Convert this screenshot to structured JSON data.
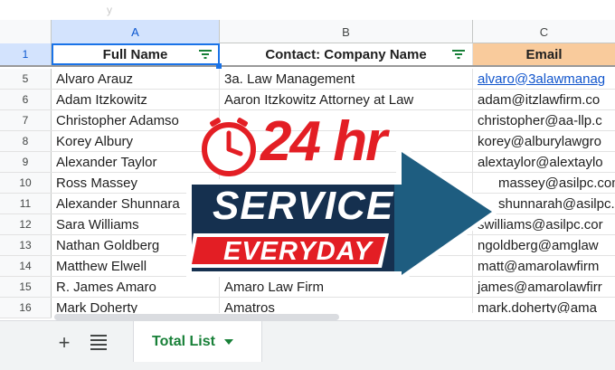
{
  "toolbar": {
    "faint_text": "y"
  },
  "columns": [
    {
      "letter": "A"
    },
    {
      "letter": "B"
    },
    {
      "letter": "C"
    }
  ],
  "header_row": {
    "number": "1",
    "cells": [
      "Full Name",
      "Contact: Company Name",
      "Email"
    ]
  },
  "rows": [
    {
      "num": "5",
      "name": "Alvaro Arauz",
      "company": "3a. Law Management",
      "email": "alvaro@3alawmanag"
    },
    {
      "num": "6",
      "name": "Adam Itzkowitz",
      "company": "Aaron Itzkowitz Attorney at Law",
      "email": "adam@itzlawfirm.co"
    },
    {
      "num": "7",
      "name": "Christopher Adamso",
      "company": "",
      "email": "christopher@aa-llp.c"
    },
    {
      "num": "8",
      "name": "Korey Albury",
      "company": "",
      "email": "korey@alburylawgro"
    },
    {
      "num": "9",
      "name": "Alexander Taylor",
      "company": "",
      "email": "alextaylor@alextaylo"
    },
    {
      "num": "10",
      "name": "Ross Massey",
      "company": "",
      "email": "massey@asilpc.com"
    },
    {
      "num": "11",
      "name": "Alexander Shunnara",
      "company": "",
      "email": "shunnarah@asilpc."
    },
    {
      "num": "12",
      "name": "Sara Williams",
      "company": "",
      "email": "swilliams@asilpc.cor"
    },
    {
      "num": "13",
      "name": "Nathan Goldberg",
      "company": "",
      "email": "ngoldberg@amglaw"
    },
    {
      "num": "14",
      "name": "Matthew Elwell",
      "company": "",
      "email": "matt@amarolawfirm"
    },
    {
      "num": "15",
      "name": "R. James Amaro",
      "company": "Amaro Law Firm",
      "email": "james@amarolawfirr"
    },
    {
      "num": "16",
      "name": "Mark Doherty",
      "company": "Amatros",
      "email": "mark.doherty@ama"
    }
  ],
  "overlay": {
    "headline": "24 hr",
    "service": "SERVICE",
    "everyday": "EVERYDAY",
    "icon": "clock-icon",
    "colors": {
      "red": "#e31e24",
      "navy": "#15304f",
      "teal": "#1e5d80"
    }
  },
  "sheet_tabs": {
    "active": "Total List"
  },
  "colors": {
    "email_header": "#f9cb9c",
    "tab_green": "#188038",
    "selection": "#1a73e8"
  }
}
